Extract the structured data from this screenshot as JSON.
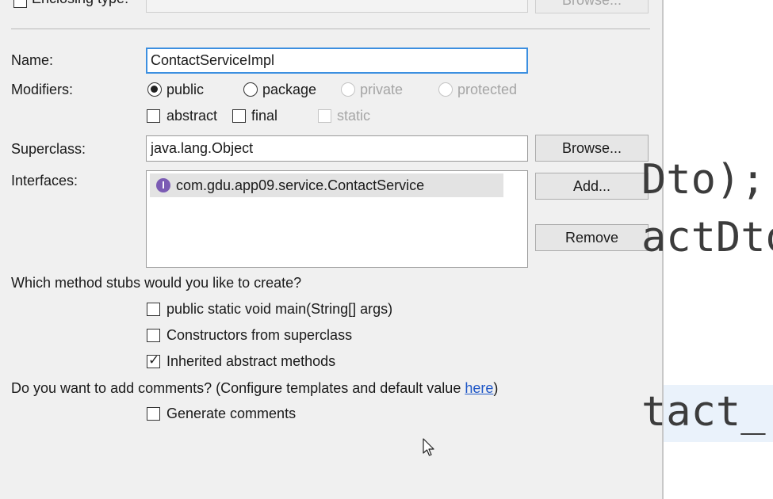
{
  "enclosing": {
    "label": "Enclosing type:",
    "value": "",
    "browse_label": "Browse..."
  },
  "name": {
    "label": "Name:",
    "value": "ContactServiceImpl"
  },
  "modifiers": {
    "label": "Modifiers:",
    "access": [
      {
        "label": "public",
        "checked": true,
        "enabled": true
      },
      {
        "label": "package",
        "checked": false,
        "enabled": true
      },
      {
        "label": "private",
        "checked": false,
        "enabled": false
      },
      {
        "label": "protected",
        "checked": false,
        "enabled": false
      }
    ],
    "flags": [
      {
        "label": "abstract",
        "checked": false,
        "enabled": true
      },
      {
        "label": "final",
        "checked": false,
        "enabled": true
      },
      {
        "label": "static",
        "checked": false,
        "enabled": false
      }
    ]
  },
  "superclass": {
    "label": "Superclass:",
    "value": "java.lang.Object",
    "browse_label": "Browse..."
  },
  "interfaces": {
    "label": "Interfaces:",
    "items": [
      {
        "icon": "interface-icon",
        "icon_glyph": "I",
        "label": "com.gdu.app09.service.ContactService"
      }
    ],
    "add_label": "Add...",
    "remove_label": "Remove"
  },
  "stubs": {
    "question": "Which method stubs would you like to create?",
    "options": [
      {
        "label": "public static void main(String[] args)",
        "checked": false
      },
      {
        "label": "Constructors from superclass",
        "checked": false
      },
      {
        "label": "Inherited abstract methods",
        "checked": true
      }
    ]
  },
  "comments": {
    "question_prefix": "Do you want to add comments? (Configure templates and default value ",
    "link_text": "here",
    "question_suffix": ")",
    "generate_label": "Generate comments",
    "generate_checked": false
  },
  "editor": {
    "lines": [
      "Dto);",
      "actDto",
      "tact_"
    ]
  }
}
